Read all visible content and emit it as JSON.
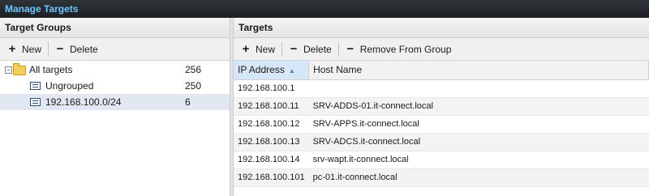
{
  "window": {
    "title": "Manage Targets"
  },
  "left_panel": {
    "title": "Target Groups",
    "toolbar": {
      "new_label": "New",
      "delete_label": "Delete"
    },
    "tree": [
      {
        "label": "All targets",
        "count": "256"
      },
      {
        "label": "Ungrouped",
        "count": "250"
      },
      {
        "label": "192.168.100.0/24",
        "count": "6"
      }
    ]
  },
  "right_panel": {
    "title": "Targets",
    "toolbar": {
      "new_label": "New",
      "delete_label": "Delete",
      "remove_label": "Remove From Group"
    },
    "columns": {
      "ip": "IP Address",
      "host": "Host Name"
    },
    "rows": [
      {
        "ip": "192.168.100.1",
        "host": ""
      },
      {
        "ip": "192.168.100.11",
        "host": "SRV-ADDS-01.it-connect.local"
      },
      {
        "ip": "192.168.100.12",
        "host": "SRV-APPS.it-connect.local"
      },
      {
        "ip": "192.168.100.13",
        "host": "SRV-ADCS.it-connect.local"
      },
      {
        "ip": "192.168.100.14",
        "host": "srv-wapt.it-connect.local"
      },
      {
        "ip": "192.168.100.101",
        "host": "pc-01.it-connect.local"
      }
    ]
  },
  "icons": {
    "add": "plus-icon",
    "remove": "minus-icon",
    "folder": "folder-icon",
    "group": "group-icon",
    "sort": "sort-ascending-icon"
  },
  "colors": {
    "title_text": "#6ec6ff",
    "titlebar_bg": "#23282c",
    "selection": "#e2e8f2",
    "sorted_header": "#d6e8f7"
  }
}
